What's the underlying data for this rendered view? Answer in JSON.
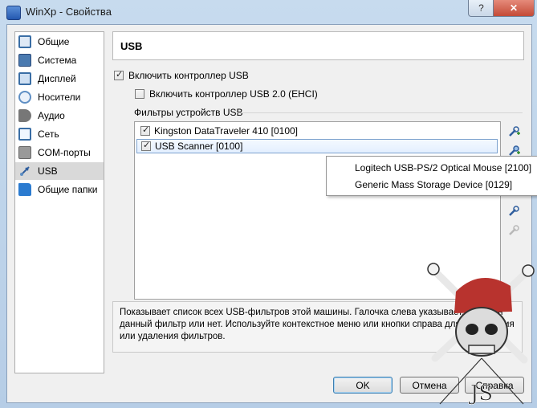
{
  "window": {
    "title": "WinXp - Свойства",
    "help_label": "?",
    "close_label": "✕"
  },
  "sidebar": {
    "items": [
      {
        "label": "Общие",
        "icon": "general-icon",
        "color": "#3a6ea5"
      },
      {
        "label": "Система",
        "icon": "system-icon",
        "color": "#4a7ab0"
      },
      {
        "label": "Дисплей",
        "icon": "display-icon",
        "color": "#3a6ea5"
      },
      {
        "label": "Носители",
        "icon": "storage-icon",
        "color": "#5f8fc4"
      },
      {
        "label": "Аудио",
        "icon": "audio-icon",
        "color": "#555555"
      },
      {
        "label": "Сеть",
        "icon": "network-icon",
        "color": "#3a6ea5"
      },
      {
        "label": "COM-порты",
        "icon": "serial-port-icon",
        "color": "#7a7a7a"
      },
      {
        "label": "USB",
        "icon": "usb-icon",
        "color": "#2f5e9e"
      },
      {
        "label": "Общие папки",
        "icon": "shared-folder-icon",
        "color": "#2b7bd0"
      }
    ],
    "selected_index": 7
  },
  "page": {
    "header": "USB",
    "enable_usb_label": "Включить контроллер USB",
    "enable_usb_checked": true,
    "enable_usb2_label": "Включить контроллер USB 2.0 (EHCI)",
    "enable_usb2_checked": false,
    "filters_label": "Фильтры устройств USB"
  },
  "filters": [
    {
      "label": "Kingston DataTraveler 410 [0100]",
      "checked": true
    },
    {
      "label": "USB Scanner [0100]",
      "checked": true
    }
  ],
  "context_menu": {
    "items": [
      "Logitech USB-PS/2 Optical Mouse [2100]",
      "Generic Mass Storage Device [0129]"
    ]
  },
  "toolbar_icons": [
    "add-empty-filter-icon",
    "add-device-filter-icon",
    "edit-filter-icon",
    "remove-filter-icon",
    "move-up-icon",
    "move-down-icon"
  ],
  "description": {
    "line1": "Показывает список всех USB-фильтров этой машины. Галочка слева указывает, включен",
    "line2": "данный фильтр или нет. Используйте контекстное меню или кнопки справа для добавления",
    "line3": "или удаления фильтров."
  },
  "buttons": {
    "ok": "OK",
    "cancel": "Отмена",
    "help": "Справка"
  },
  "watermark": {
    "text": "JS"
  },
  "colors": {
    "selection_border": "#7da2ce",
    "accent": "#3c7fb1",
    "titlebar": "#c7dbee"
  }
}
